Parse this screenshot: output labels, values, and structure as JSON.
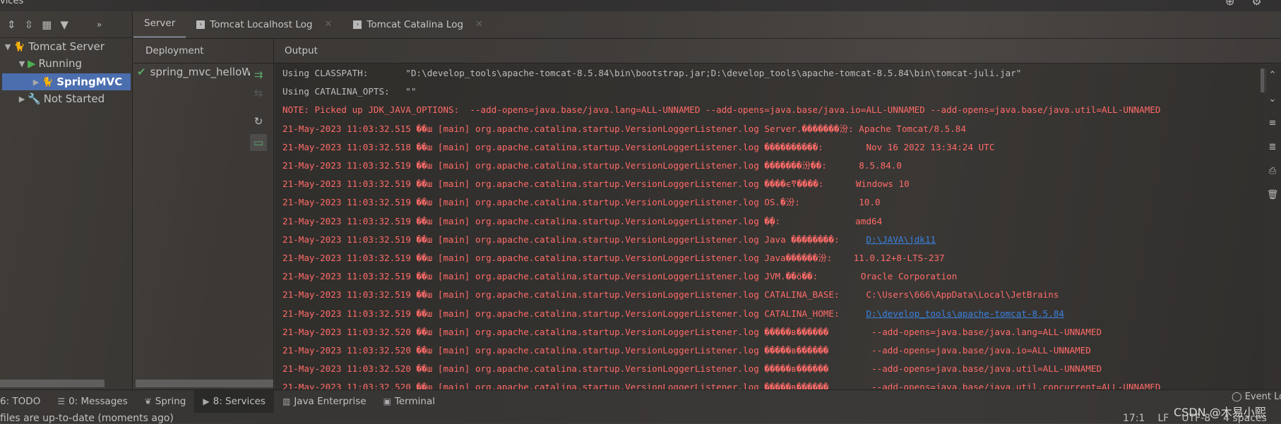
{
  "window_title": "vices",
  "left_toolbar": {
    "icons": [
      "expand-all-icon",
      "collapse-all-icon",
      "group-icon",
      "filter-icon"
    ],
    "more": "»"
  },
  "tree": [
    {
      "label": "Tomcat Server",
      "icon": "tomcat-icon",
      "expanded": true
    },
    {
      "label": "Running",
      "icon": "run-icon",
      "expanded": true
    },
    {
      "label": "SpringMVC",
      "icon": "tomcat-running-icon",
      "selected": true
    },
    {
      "label": "Not Started",
      "icon": "wrench-icon",
      "expanded": false
    }
  ],
  "tabs": [
    {
      "label": "Server",
      "active": true
    },
    {
      "label": "Tomcat Localhost Log",
      "closable": true
    },
    {
      "label": "Tomcat Catalina Log",
      "closable": true
    }
  ],
  "deployment": {
    "header": "Deployment",
    "items": [
      {
        "label": "spring_mvc_helloWorld",
        "status": "deployed"
      }
    ]
  },
  "output": {
    "header": "Output",
    "colors": {
      "info": "#bdbdbd",
      "error": "#ff6b68",
      "link": "#3b82e0"
    },
    "lines": [
      {
        "type": "gray",
        "text": "Using CLASSPATH:       \"D:\\develop_tools\\apache-tomcat-8.5.84\\bin\\bootstrap.jar;D:\\develop_tools\\apache-tomcat-8.5.84\\bin\\tomcat-juli.jar\""
      },
      {
        "type": "gray",
        "text": "Using CATALINA_OPTS:   \"\""
      },
      {
        "type": "red",
        "text": "NOTE: Picked up JDK_JAVA_OPTIONS:  --add-opens=java.base/java.lang=ALL-UNNAMED --add-opens=java.base/java.io=ALL-UNNAMED --add-opens=java.base/java.util=ALL-UNNAMED"
      },
      {
        "type": "red",
        "text": "21-May-2023 11:03:32.515 ��ш [main] org.apache.catalina.startup.VersionLoggerListener.log Server.�������汾: Apache Tomcat/8.5.84"
      },
      {
        "type": "red",
        "text": "21-May-2023 11:03:32.518 ��ш [main] org.apache.catalina.startup.VersionLoggerListener.log ����������:        Nov 16 2022 13:34:24 UTC"
      },
      {
        "type": "red",
        "text": "21-May-2023 11:03:32.519 ��ш [main] org.apache.catalina.startup.VersionLoggerListener.log �������汾��:      8.5.84.0"
      },
      {
        "type": "red",
        "text": "21-May-2023 11:03:32.519 ��ш [main] org.apache.catalina.startup.VersionLoggerListener.log ����ϵͳ����:      Windows 10"
      },
      {
        "type": "red",
        "text": "21-May-2023 11:03:32.519 ��ш [main] org.apache.catalina.startup.VersionLoggerListener.log OS.�汾:           10.0"
      },
      {
        "type": "red",
        "text": "21-May-2023 11:03:32.519 ��ш [main] org.apache.catalina.startup.VersionLoggerListener.log �ܹ�:              amd64"
      },
      {
        "type": "red",
        "text": "21-May-2023 11:03:32.519 ��ш [main] org.apache.catalina.startup.VersionLoggerListener.log Java ��������:     ",
        "link": "D:\\JAVA\\jdk11"
      },
      {
        "type": "red",
        "text": "21-May-2023 11:03:32.519 ��ш [main] org.apache.catalina.startup.VersionLoggerListener.log Java������汾:    11.0.12+8-LTS-237"
      },
      {
        "type": "red",
        "text": "21-May-2023 11:03:32.519 ��ш [main] org.apache.catalina.startup.VersionLoggerListener.log JVM.��ö��:        Oracle Corporation"
      },
      {
        "type": "red",
        "text": "21-May-2023 11:03:32.519 ��ш [main] org.apache.catalina.startup.VersionLoggerListener.log CATALINA_BASE:     C:\\Users\\666\\AppData\\Local\\JetBrains"
      },
      {
        "type": "red",
        "text": "21-May-2023 11:03:32.519 ��ш [main] org.apache.catalina.startup.VersionLoggerListener.log CATALINA_HOME:     ",
        "link": "D:\\develop_tools\\apache-tomcat-8.5.84"
      },
      {
        "type": "red",
        "text": "21-May-2023 11:03:32.520 ��ш [main] org.apache.catalina.startup.VersionLoggerListener.log �����в������        --add-opens=java.base/java.lang=ALL-UNNAMED"
      },
      {
        "type": "red",
        "text": "21-May-2023 11:03:32.520 ��ш [main] org.apache.catalina.startup.VersionLoggerListener.log �����в������        --add-opens=java.base/java.io=ALL-UNNAMED"
      },
      {
        "type": "red",
        "text": "21-May-2023 11:03:32.520 ��ш [main] org.apache.catalina.startup.VersionLoggerListener.log �����в������        --add-opens=java.base/java.util=ALL-UNNAMED"
      },
      {
        "type": "red",
        "text": "21-May-2023 11:03:32.520 ��ш [main] org.apache.catalina.startup.VersionLoggerListener.log �����в������        --add-opens=java.base/java.util.concurrent=ALL-UNNAMED"
      }
    ]
  },
  "tool_windows": [
    {
      "label": "6: TODO",
      "icon": ""
    },
    {
      "label": "0: Messages",
      "icon": "messages-icon"
    },
    {
      "label": "Spring",
      "icon": "spring-leaf-icon"
    },
    {
      "label": "8: Services",
      "icon": "services-icon",
      "active": true
    },
    {
      "label": "Java Enterprise",
      "icon": "java-enterprise-icon"
    },
    {
      "label": "Terminal",
      "icon": "terminal-icon"
    }
  ],
  "event_log": "Event Log",
  "watermark": "CSDN @木易小熙",
  "status": {
    "message": "files are up-to-date (moments ago)",
    "position": "17:1",
    "line_sep": "LF",
    "encoding": "UTF-8",
    "indent": "4 spaces"
  }
}
